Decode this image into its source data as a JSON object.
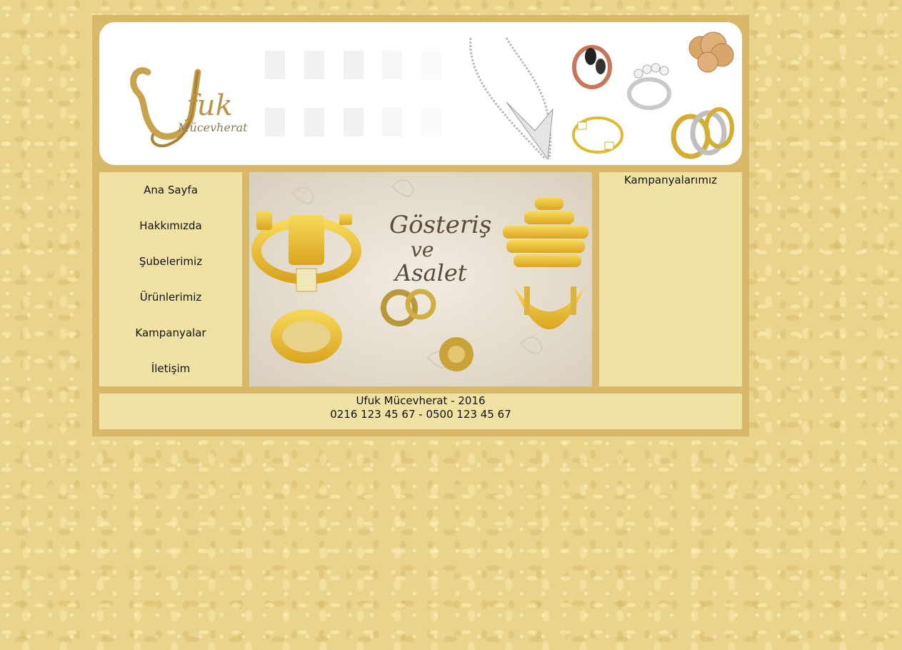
{
  "site": {
    "logo_text": "Ufuk",
    "logo_sub": "Mücevherat"
  },
  "menu": {
    "items": [
      {
        "label": "Ana Sayfa"
      },
      {
        "label": "Hakkımızda"
      },
      {
        "label": "Şubelerimiz"
      },
      {
        "label": "Ürünlerimiz"
      },
      {
        "label": "Kampanyalar"
      },
      {
        "label": "İletişim"
      }
    ]
  },
  "banner": {
    "line1": "Gösteriş",
    "line2": "ve",
    "line3": "Asalet"
  },
  "side": {
    "title": "Kampanyalarımız"
  },
  "footer": {
    "line1": "Ufuk Mücevherat - 2016",
    "line2": "0216 123 45 67 - 0500 123 45 67"
  },
  "colors": {
    "page_bg": "#e9d48c",
    "frame": "#d9b86a",
    "panel": "#efe2a2",
    "gold": "#c8a24c"
  },
  "icons": [
    "logo",
    "necklace",
    "ring",
    "coin",
    "bracelet"
  ]
}
